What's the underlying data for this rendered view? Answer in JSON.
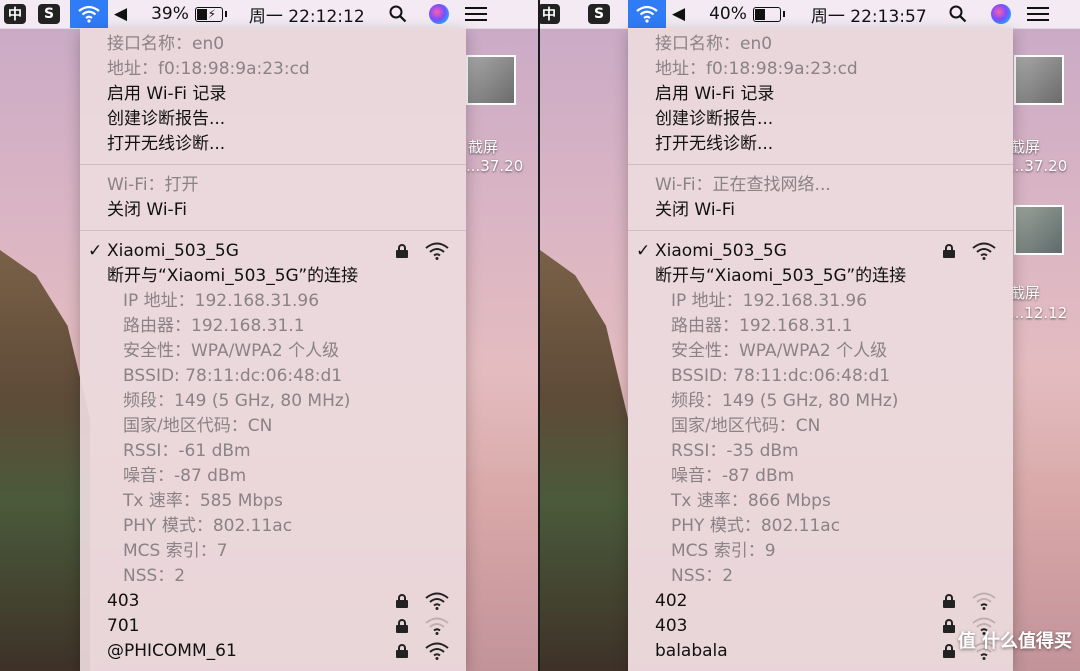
{
  "left": {
    "menubar": {
      "ime_label": "中",
      "app_glyph": "S",
      "volume_glyph": "◀",
      "battery": "39%",
      "battery_level_fraction": 0.39,
      "battery_glyph": "⚡",
      "clock": "周一 22:12:12"
    },
    "menu": {
      "interface_name": "接口名称：en0",
      "address": "地址：f0:18:98:9a:23:cd",
      "enable_logging": "启用 Wi-Fi 记录",
      "create_report": "创建诊断报告...",
      "open_diagnostics": "打开无线诊断...",
      "wifi_status": "Wi-Fi：打开",
      "turn_off": "关闭 Wi-Fi",
      "connected_network": "Xiaomi_503_5G",
      "disconnect": "断开与“Xiaomi_503_5G”的连接",
      "details": [
        "IP 地址：192.168.31.96",
        "路由器：192.168.31.1",
        "安全性：WPA/WPA2 个人级",
        "BSSID: 78:11:dc:06:48:d1",
        "频段：149 (5 GHz, 80 MHz)",
        "国家/地区代码：CN",
        "RSSI：-61 dBm",
        "噪音：-87 dBm",
        "Tx 速率：585 Mbps",
        "PHY 模式：802.11ac",
        "MCS 索引：7",
        "NSS：2"
      ],
      "networks": [
        {
          "name": "403",
          "strength": 3
        },
        {
          "name": "701",
          "strength": 1
        },
        {
          "name": "@PHICOMM_61",
          "strength": 3
        }
      ]
    },
    "desktop": {
      "label_1": "截屏",
      "label_2": "...37.20"
    }
  },
  "right": {
    "menubar": {
      "ime_label": "中",
      "app_glyph": "S",
      "volume_glyph": "◀",
      "battery": "40%",
      "battery_level_fraction": 0.4,
      "clock": "周一 22:13:57"
    },
    "menu": {
      "interface_name": "接口名称：en0",
      "address": "地址：f0:18:98:9a:23:cd",
      "enable_logging": "启用 Wi-Fi 记录",
      "create_report": "创建诊断报告...",
      "open_diagnostics": "打开无线诊断...",
      "wifi_status": "Wi-Fi：正在查找网络...",
      "turn_off": "关闭 Wi-Fi",
      "connected_network": "Xiaomi_503_5G",
      "disconnect": "断开与“Xiaomi_503_5G”的连接",
      "details": [
        "IP 地址：192.168.31.96",
        "路由器：192.168.31.1",
        "安全性：WPA/WPA2 个人级",
        "BSSID: 78:11:dc:06:48:d1",
        "频段：149 (5 GHz, 80 MHz)",
        "国家/地区代码：CN",
        "RSSI：-35 dBm",
        "噪音：-87 dBm",
        "Tx 速率：866 Mbps",
        "PHY 模式：802.11ac",
        "MCS 索引：9",
        "NSS：2"
      ],
      "networks": [
        {
          "name": "402",
          "strength": 1
        },
        {
          "name": "403",
          "strength": 1
        },
        {
          "name": "balabala",
          "strength": 1
        }
      ]
    },
    "desktop": {
      "label_1": "截屏",
      "label_2": "...37.20",
      "label_3": "截屏",
      "label_4": "...12.12"
    },
    "watermark": "值 什么值得买"
  },
  "icons": {
    "check": "✓"
  }
}
